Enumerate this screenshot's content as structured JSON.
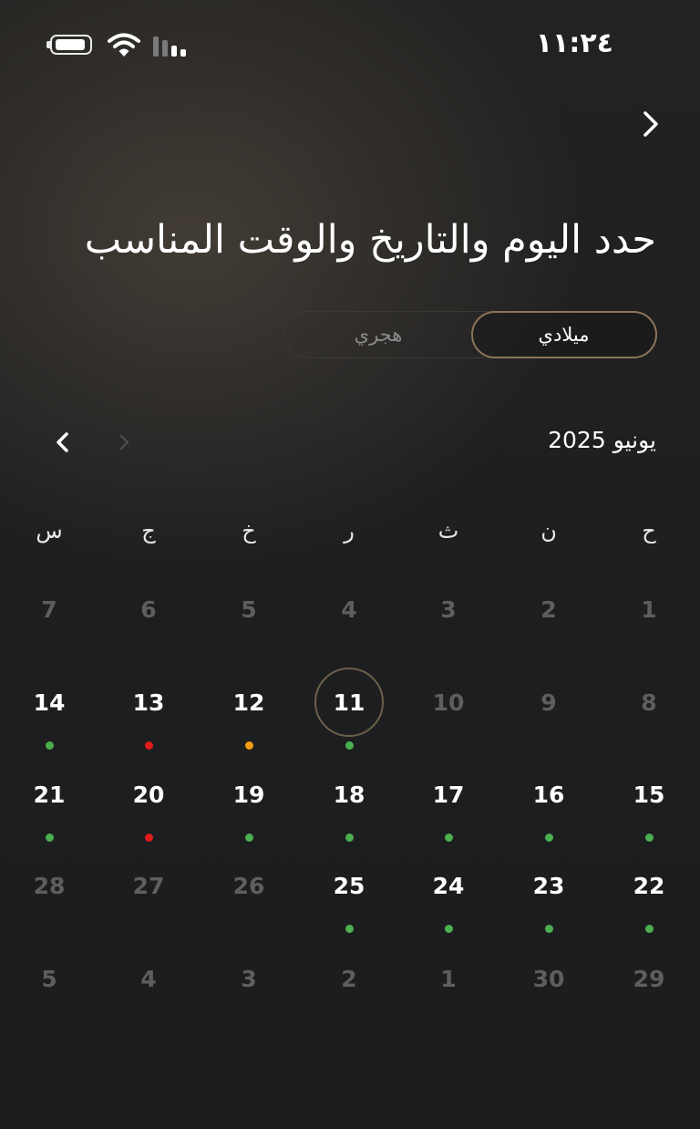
{
  "status_bar": {
    "time": "١١:٢٤",
    "battery_icon": "battery-icon",
    "wifi_icon": "wifi-icon",
    "signal_icon": "cellular-signal-icon"
  },
  "nav": {
    "back_icon": "chevron-right-icon"
  },
  "title": "حدد اليوم والتاريخ والوقت المناسب",
  "calendar_type": {
    "options": [
      "ميلادي",
      "هجري"
    ],
    "selected": "ميلادي"
  },
  "month": {
    "label": "يونيو 2025",
    "next_icon": "chevron-left-icon",
    "prev_icon": "chevron-right-icon"
  },
  "weekdays": [
    "ح",
    "ن",
    "ث",
    "ر",
    "خ",
    "ج",
    "س"
  ],
  "colors": {
    "available": "#4caf50",
    "limited": "#f39c12",
    "unavailable": "#e01b1b",
    "accent_border": "#8a7658"
  },
  "weeks": [
    [
      {
        "day": "1",
        "state": "muted",
        "dot": ""
      },
      {
        "day": "2",
        "state": "muted",
        "dot": ""
      },
      {
        "day": "3",
        "state": "muted",
        "dot": ""
      },
      {
        "day": "4",
        "state": "muted",
        "dot": ""
      },
      {
        "day": "5",
        "state": "muted",
        "dot": ""
      },
      {
        "day": "6",
        "state": "muted",
        "dot": ""
      },
      {
        "day": "7",
        "state": "muted",
        "dot": ""
      }
    ],
    [
      {
        "day": "8",
        "state": "muted",
        "dot": ""
      },
      {
        "day": "9",
        "state": "muted",
        "dot": ""
      },
      {
        "day": "10",
        "state": "muted",
        "dot": ""
      },
      {
        "day": "11",
        "state": "selected",
        "dot": "available"
      },
      {
        "day": "12",
        "state": "active",
        "dot": "limited"
      },
      {
        "day": "13",
        "state": "active",
        "dot": "unavailable"
      },
      {
        "day": "14",
        "state": "active",
        "dot": "available"
      }
    ],
    [
      {
        "day": "15",
        "state": "active",
        "dot": "available"
      },
      {
        "day": "16",
        "state": "active",
        "dot": "available"
      },
      {
        "day": "17",
        "state": "active",
        "dot": "available"
      },
      {
        "day": "18",
        "state": "active",
        "dot": "available"
      },
      {
        "day": "19",
        "state": "active",
        "dot": "available"
      },
      {
        "day": "20",
        "state": "active",
        "dot": "unavailable"
      },
      {
        "day": "21",
        "state": "active",
        "dot": "available"
      }
    ],
    [
      {
        "day": "22",
        "state": "active",
        "dot": "available"
      },
      {
        "day": "23",
        "state": "active",
        "dot": "available"
      },
      {
        "day": "24",
        "state": "active",
        "dot": "available"
      },
      {
        "day": "25",
        "state": "active",
        "dot": "available"
      },
      {
        "day": "26",
        "state": "muted",
        "dot": ""
      },
      {
        "day": "27",
        "state": "muted",
        "dot": ""
      },
      {
        "day": "28",
        "state": "muted",
        "dot": ""
      }
    ],
    [
      {
        "day": "29",
        "state": "muted",
        "dot": ""
      },
      {
        "day": "30",
        "state": "muted",
        "dot": ""
      },
      {
        "day": "1",
        "state": "muted",
        "dot": ""
      },
      {
        "day": "2",
        "state": "muted",
        "dot": ""
      },
      {
        "day": "3",
        "state": "muted",
        "dot": ""
      },
      {
        "day": "4",
        "state": "muted",
        "dot": ""
      },
      {
        "day": "5",
        "state": "muted",
        "dot": ""
      }
    ]
  ]
}
